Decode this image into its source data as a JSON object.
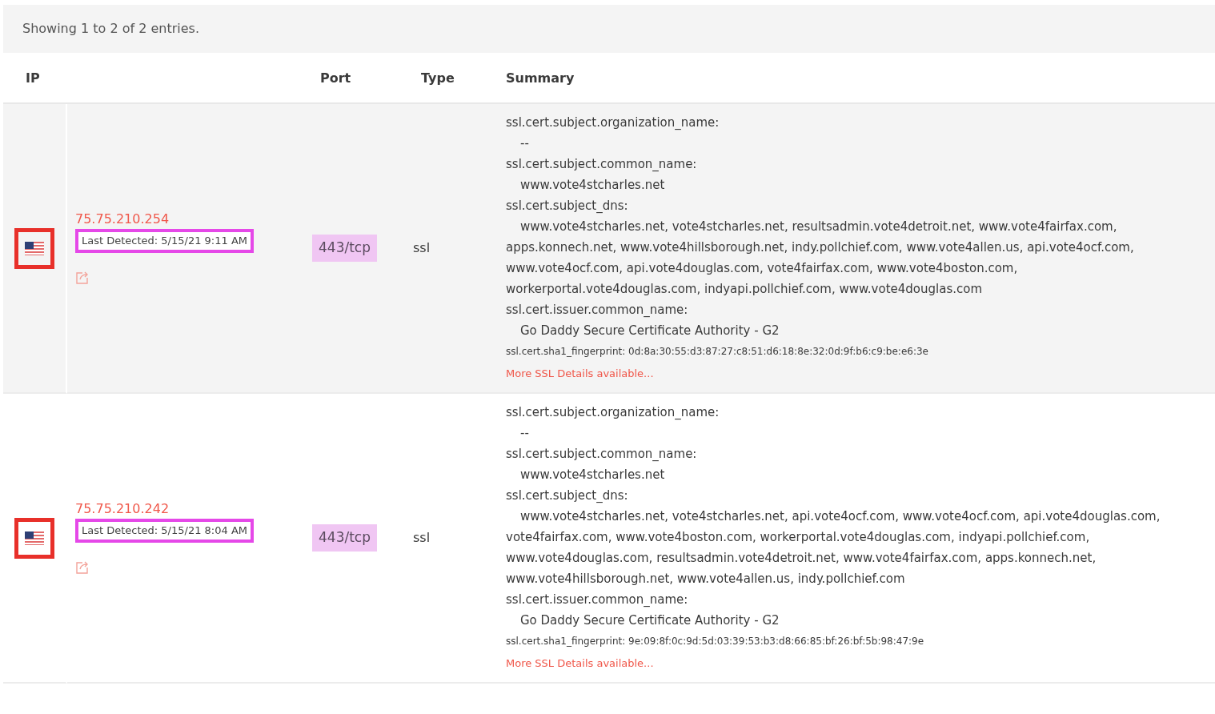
{
  "info_bar": {
    "text": "Showing 1 to 2 of 2 entries."
  },
  "table": {
    "columns": [
      "IP",
      "Port",
      "Type",
      "Summary"
    ],
    "rows": [
      {
        "annotated": true,
        "ip": "75.75.210.254",
        "last_detected": "Last Detected: 5/15/21 9:11 AM",
        "port": "443/tcp",
        "type": "ssl",
        "summary": [
          {
            "label": "ssl.cert.subject.organization_name:",
            "value": "--"
          },
          {
            "label": "ssl.cert.subject.common_name:",
            "value": "www.vote4stcharles.net"
          },
          {
            "label": "ssl.cert.subject_dns:",
            "value": "www.vote4stcharles.net, vote4stcharles.net, resultsadmin.vote4detroit.net, www.vote4fairfax.com, apps.konnech.net, www.vote4hillsborough.net, indy.pollchief.com, www.vote4allen.us, api.vote4ocf.com, www.vote4ocf.com, api.vote4douglas.com, vote4fairfax.com, www.vote4boston.com, workerportal.vote4douglas.com, indyapi.pollchief.com, www.vote4douglas.com"
          },
          {
            "label": "ssl.cert.issuer.common_name:",
            "value": "Go Daddy Secure Certificate Authority - G2"
          }
        ],
        "fingerprint": "ssl.cert.sha1_fingerprint: 0d:8a:30:55:d3:87:27:c8:51:d6:18:8e:32:0d:9f:b6:c9:be:e6:3e",
        "more_link": "More SSL Details available..."
      },
      {
        "annotated": true,
        "ip": "75.75.210.242",
        "last_detected": "Last Detected: 5/15/21 8:04 AM",
        "port": "443/tcp",
        "type": "ssl",
        "summary": [
          {
            "label": "ssl.cert.subject.organization_name:",
            "value": "--"
          },
          {
            "label": "ssl.cert.subject.common_name:",
            "value": "www.vote4stcharles.net"
          },
          {
            "label": "ssl.cert.subject_dns:",
            "value": "www.vote4stcharles.net, vote4stcharles.net, api.vote4ocf.com, www.vote4ocf.com, api.vote4douglas.com, vote4fairfax.com, www.vote4boston.com, workerportal.vote4douglas.com, indyapi.pollchief.com, www.vote4douglas.com, resultsadmin.vote4detroit.net, www.vote4fairfax.com, apps.konnech.net, www.vote4hillsborough.net, www.vote4allen.us, indy.pollchief.com"
          },
          {
            "label": "ssl.cert.issuer.common_name:",
            "value": "Go Daddy Secure Certificate Authority - G2"
          }
        ],
        "fingerprint": "ssl.cert.sha1_fingerprint: 9e:09:8f:0c:9d:5d:03:39:53:b3:d8:66:85:bf:26:bf:5b:98:47:9e",
        "more_link": "More SSL Details available..."
      }
    ]
  }
}
